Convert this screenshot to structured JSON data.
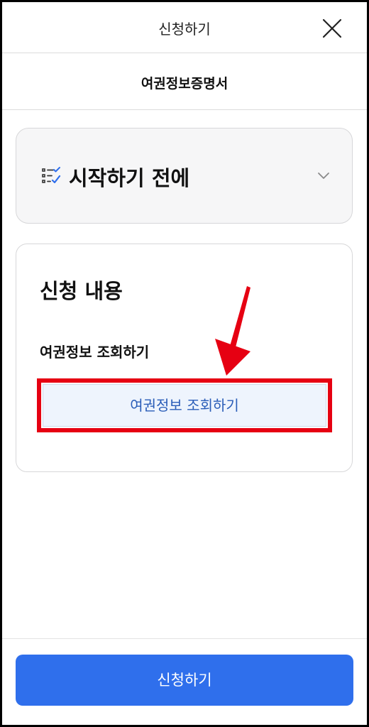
{
  "header": {
    "title": "신청하기",
    "close_icon": "close-icon"
  },
  "subheader": {
    "title": "여권정보증명서"
  },
  "before_start": {
    "icon": "checklist-icon",
    "title": "시작하기 전에",
    "toggle_icon": "chevron-down-icon"
  },
  "application": {
    "title": "신청 내용",
    "field_label": "여권정보 조회하기",
    "lookup_button_label": "여권정보 조회하기",
    "highlight_color": "#e60012",
    "arrow_color": "#e60012"
  },
  "footer": {
    "submit_label": "신청하기",
    "submit_color": "#2f6fec"
  }
}
